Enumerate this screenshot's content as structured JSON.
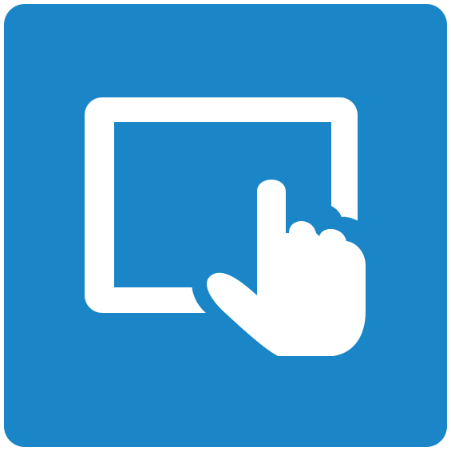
{
  "icon": {
    "name": "tablet-touch-icon",
    "tile_color": "#1a86c7",
    "glyph_color": "#ffffff"
  }
}
